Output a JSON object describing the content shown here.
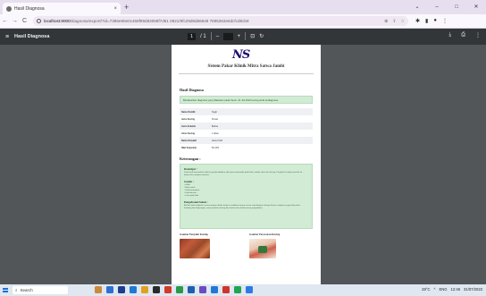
{
  "browser": {
    "tab_title": "Hasil Diagnosa",
    "tab_close": "×",
    "new_tab": "+",
    "window_controls": [
      "⌄",
      "–",
      "□",
      "✕"
    ],
    "nav": {
      "back": "←",
      "forward": "→",
      "reload": "C"
    },
    "url_host": "localhost:8000",
    "url_path": "/diagnosa/export/?id=7386e80e0c468f99d83058f7d61 0821/9fc29d8d86849 7895363e6dcfcd8cb8"
  },
  "pdf_toolbar": {
    "menu_icon": "≡",
    "document_title": "Hasil Diagnosa",
    "page_current": "1",
    "page_total": "/ 1",
    "zoom_out": "–",
    "zoom_in": "+",
    "download_icon": "⤓",
    "print_icon": "⎙",
    "more_icon": "⋮"
  },
  "document": {
    "logo": "NS",
    "brand": "Sistem Pakar Klinik Mitra Satwa Jambi",
    "heading": "Hasil Diagnosa",
    "alert_text": "Berdasarkan diagnosa yang dilakukan pada Senin, 31 Juli 2023 kucing anda terdiagnosa:",
    "table_rows": [
      {
        "key": "Nama Pemilik",
        "value": "Tegar"
      },
      {
        "key": "Jenis Kucing",
        "value": "Persia"
      },
      {
        "key": "Jenis Kelamin",
        "value": "Betina"
      },
      {
        "key": "Umur Kucing",
        "value": "1 tahun"
      },
      {
        "key": "Nama Penyakit",
        "value": "Jamur Kulit"
      },
      {
        "key": "Nilai Kepastian",
        "value": "82.14%"
      }
    ],
    "keterangan_heading": "Keterangan :",
    "sections": [
      {
        "title": "Deskripsi :",
        "text": "Jamur kulit merupakan infeksi yang disebabkan oleh jamur dermatofit pada kulit, rambut, dan kuku kucing. Penyakit ini dapat menular ke hewan lain maupun manusia."
      },
      {
        "title": "Gejala :",
        "items": [
          "• Gatal",
          "• Bulu rontok",
          "• Kulit kemerahan",
          "• Kulit bersisik",
          "• Luka pada kulit"
        ]
      },
      {
        "title": "Pengobatan/Solusi :",
        "text": "Berikan obat antijamur sesuai anjuran dokter hewan, mandikan kucing secara rutin dengan shampo khusus antijamur, jaga kebersihan kandang dan lingkungan, serta pisahkan kucing dari hewan lain selama masa pengobatan."
      }
    ],
    "caption_left": "Gambar Penyakit Kucing",
    "caption_right": "Gambar Perawatan Kucing"
  },
  "taskbar": {
    "search_placeholder": "Search",
    "tray": [
      "28°C",
      "^",
      "ENG",
      "12:46",
      "31/07/2023"
    ]
  }
}
